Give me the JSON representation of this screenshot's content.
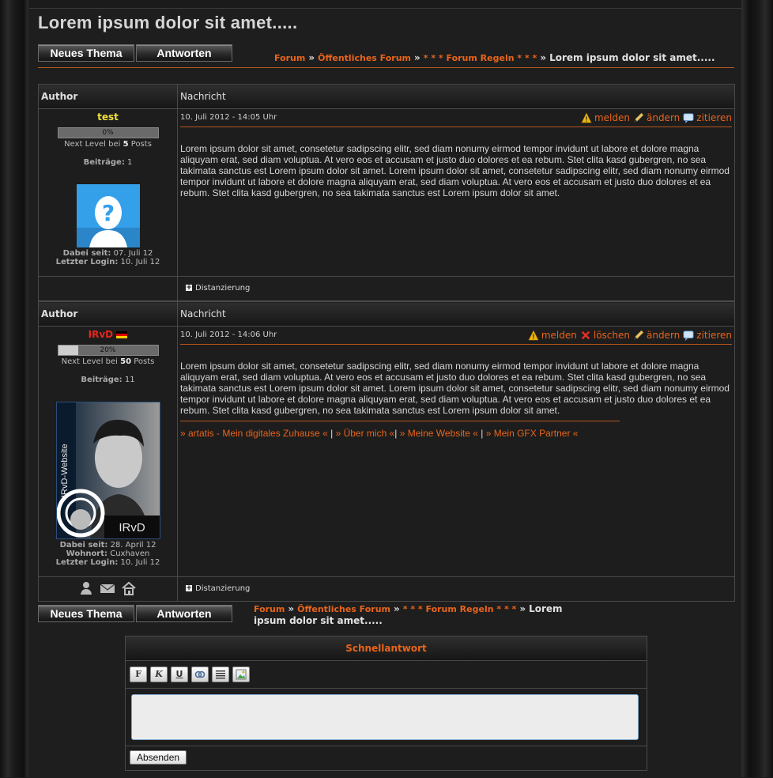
{
  "thread_title": "Lorem ipsum dolor sit amet.....",
  "buttons": {
    "new_thread": "Neues Thema",
    "reply": "Antworten"
  },
  "breadcrumb": {
    "items": [
      "Forum",
      "Öffentliches Forum",
      "* * * Forum Regeln * * *"
    ],
    "separator": "»",
    "current": "Lorem ipsum dolor sit amet....."
  },
  "breadcrumb_bottom": {
    "current_line1": "Lorem",
    "current_line2": "ipsum dolor sit amet....."
  },
  "table_headers": {
    "author": "Author",
    "message": "Nachricht"
  },
  "post_body": "Lorem ipsum dolor sit amet, consetetur sadipscing elitr, sed diam nonumy eirmod tempor invidunt ut labore et dolore magna aliquyam erat, sed diam voluptua. At vero eos et accusam et justo duo dolores et ea rebum. Stet clita kasd gubergren, no sea takimata sanctus est Lorem ipsum dolor sit amet. Lorem ipsum dolor sit amet, consetetur sadipscing elitr, sed diam nonumy eirmod tempor invidunt ut labore et dolore magna aliquyam erat, sed diam voluptua. At vero eos et accusam et justo duo dolores et ea rebum. Stet clita kasd gubergren, no sea takimata sanctus est Lorem ipsum dolor sit amet.",
  "posts": [
    {
      "author": "test",
      "author_color": "#f0e03c",
      "level_pct": "0%",
      "level_fraction": 0.0,
      "next_level_prefix": "Next Level bei",
      "next_level_posts": "5",
      "next_level_suffix": "Posts",
      "posts_label": "Beiträge:",
      "posts_count": "1",
      "since_label": "Dabei seit:",
      "since": "07. Juli 12",
      "login_label": "Letzter Login:",
      "login": "10. Juli 12",
      "date": "10. Juli 2012 - 14:05 Uhr",
      "actions": {
        "report": "melden",
        "edit": "ändern",
        "quote": "zitieren"
      },
      "footer_label": "Distanzierung"
    },
    {
      "author": "IRvD",
      "author_color": "#e8261b",
      "level_pct": "20%",
      "level_fraction": 0.2,
      "next_level_prefix": "Next Level bei",
      "next_level_posts": "50",
      "next_level_suffix": "Posts",
      "posts_label": "Beiträge:",
      "posts_count": "11",
      "since_label": "Dabei seit:",
      "since": "28. April 12",
      "residence_label": "Wohnort:",
      "residence": "Cuxhaven",
      "login_label": "Letzter Login:",
      "login": "10. Juli 12",
      "avatar_side_text": "IRvD-Website",
      "avatar_bottom_text": "IRvD",
      "date": "10. Juli 2012 - 14:06 Uhr",
      "actions": {
        "report": "melden",
        "delete": "löschen",
        "edit": "ändern",
        "quote": "zitieren"
      },
      "signature": {
        "link1": "» artatis - Mein digitales Zuhause «",
        "link2": "» Über mich «",
        "link3": "» Meine Website «",
        "link4": "» Mein GFX Partner «"
      },
      "footer_label": "Distanzierung"
    }
  ],
  "quick_reply": {
    "title": "Schnellantwort",
    "toolbar": [
      "F",
      "K",
      "U",
      "link-icon",
      "align-icon",
      "image-icon"
    ],
    "send_label": "Absenden"
  },
  "colors": {
    "accent": "#e8641b",
    "background": "#1d1d1d"
  }
}
